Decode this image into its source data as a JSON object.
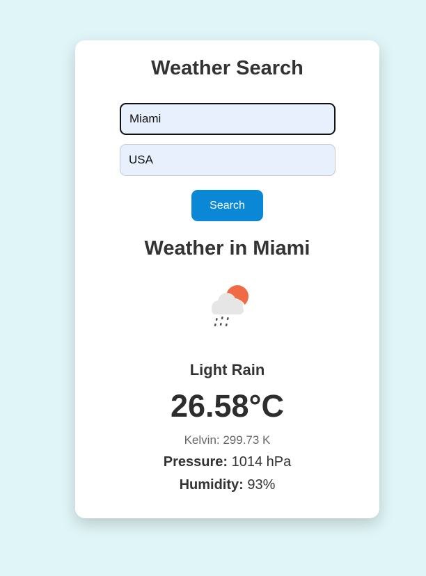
{
  "app": {
    "title": "Weather Search"
  },
  "search": {
    "city_value": "Miami",
    "country_value": "USA",
    "button_label": "Search"
  },
  "result": {
    "heading": "Weather in Miami",
    "icon": "rain-cloud-sun-icon",
    "description": "Light Rain",
    "temperature": "26.58°C",
    "kelvin": "Kelvin: 299.73 K",
    "pressure_label": "Pressure:",
    "pressure_value": "1014 hPa",
    "humidity_label": "Humidity:",
    "humidity_value": "93%"
  },
  "colors": {
    "page_background": "#e0f5f7",
    "card_background": "#ffffff",
    "button": "#0a88d6",
    "input_background": "#e8f0fe",
    "sun": "#f06a45"
  }
}
